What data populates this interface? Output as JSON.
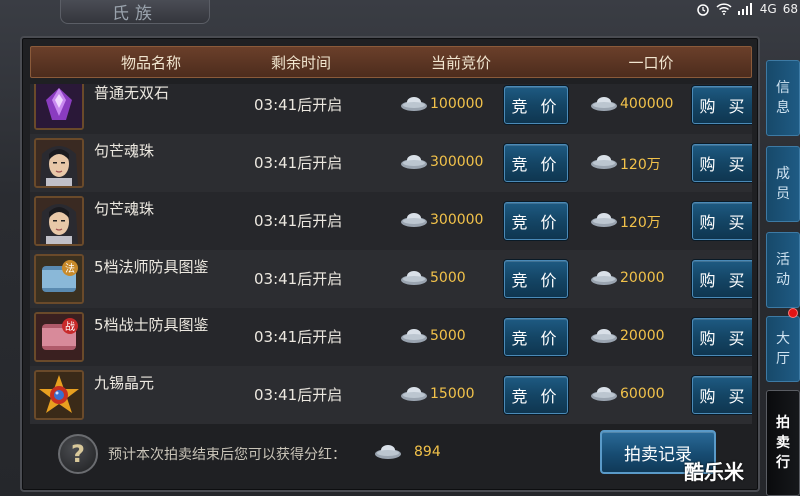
{
  "window": {
    "title": "氏族"
  },
  "status_bar": {
    "network": "4G",
    "battery": "68"
  },
  "table": {
    "columns": [
      "物品名称",
      "剩余时间",
      "当前竞价",
      "一口价"
    ],
    "rows": [
      {
        "name": "普通无双石",
        "remain": "03:41后开启",
        "bid": "100000",
        "bid_btn": "竞 价",
        "buyout": "400000",
        "buy_btn": "购 买",
        "icon": "purple-gem-icon"
      },
      {
        "name": "句芒魂珠",
        "remain": "03:41后开启",
        "bid": "300000",
        "bid_btn": "竞 价",
        "buyout": "120万",
        "buy_btn": "购 买",
        "icon": "hero-portrait-icon"
      },
      {
        "name": "句芒魂珠",
        "remain": "03:41后开启",
        "bid": "300000",
        "bid_btn": "竞 价",
        "buyout": "120万",
        "buy_btn": "购 买",
        "icon": "hero-portrait-icon"
      },
      {
        "name": "5档法师防具图鉴",
        "remain": "03:41后开启",
        "bid": "5000",
        "bid_btn": "竞 价",
        "buyout": "20000",
        "buy_btn": "购 买",
        "icon": "scroll-mage-icon"
      },
      {
        "name": "5档战士防具图鉴",
        "remain": "03:41后开启",
        "bid": "5000",
        "bid_btn": "竞 价",
        "buyout": "20000",
        "buy_btn": "购 买",
        "icon": "scroll-warrior-icon"
      },
      {
        "name": "九锡晶元",
        "remain": "03:41后开启",
        "bid": "15000",
        "bid_btn": "竞 价",
        "buyout": "60000",
        "buy_btn": "购 买",
        "icon": "star-crystal-icon"
      }
    ]
  },
  "footer": {
    "help": "?",
    "text": "预计本次拍卖结束后您可以获得分红：",
    "value": "894",
    "record_btn": "拍卖记录"
  },
  "side_tabs": [
    {
      "label": "信息",
      "chars": [
        "信",
        "息"
      ]
    },
    {
      "label": "成员",
      "chars": [
        "成",
        "员"
      ]
    },
    {
      "label": "活动",
      "chars": [
        "活",
        "动"
      ]
    },
    {
      "label": "大厅",
      "chars": [
        "大",
        "厅"
      ]
    },
    {
      "label": "拍卖行",
      "chars": [
        "拍",
        "卖",
        "行"
      ]
    }
  ],
  "watermark": "酷乐米",
  "colors": {
    "price": "#f2c24a",
    "header_bg": "#6a3f2a",
    "button_blue": "#1e5a82",
    "notification_dot": "#e21414"
  }
}
